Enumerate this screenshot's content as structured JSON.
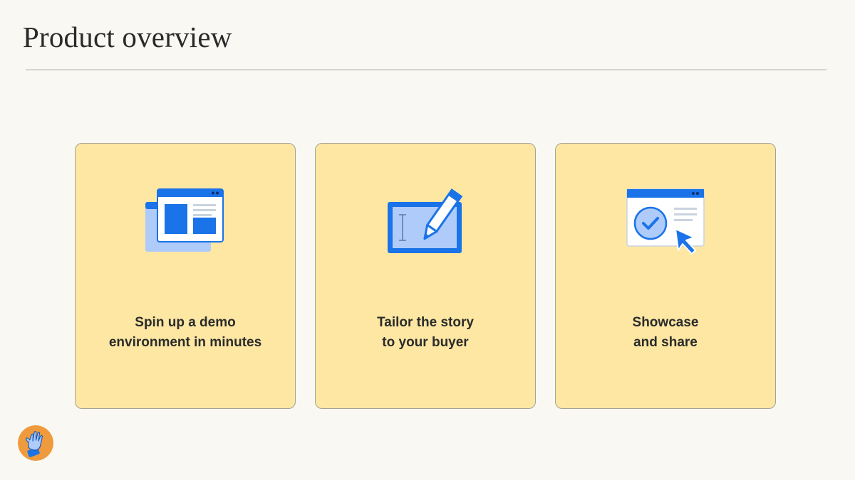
{
  "slide": {
    "title": "Product overview"
  },
  "cards": [
    {
      "line1": "Spin up a demo",
      "line2": "environment in minutes",
      "icon": "browser-windows-icon"
    },
    {
      "line1": "Tailor the story",
      "line2": "to your buyer",
      "icon": "pencil-tablet-icon"
    },
    {
      "line1": "Showcase",
      "line2": "and share",
      "icon": "checkmark-cursor-icon"
    }
  ],
  "avatar": {
    "icon": "waving-hand-icon"
  },
  "colors": {
    "background": "#f9f8f3",
    "card": "#fde7a3",
    "accent_blue": "#1a73e8",
    "light_blue": "#aecbfa",
    "avatar": "#ef9a3c"
  }
}
